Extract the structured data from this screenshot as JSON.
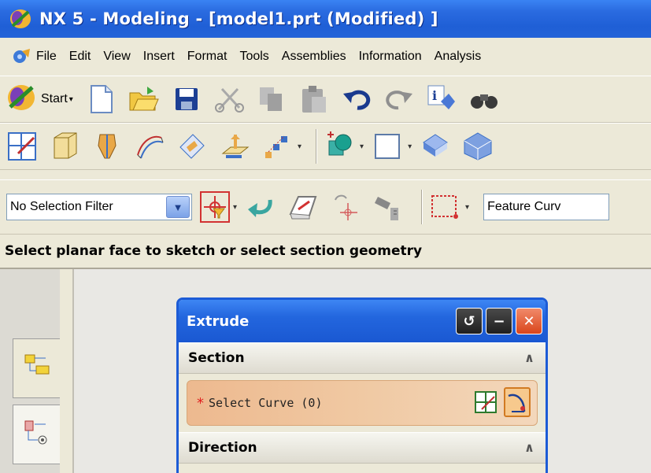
{
  "window": {
    "title": "NX 5 - Modeling - [model1.prt (Modified) ]"
  },
  "menu": {
    "items": [
      {
        "label": "File"
      },
      {
        "label": "Edit"
      },
      {
        "label": "View"
      },
      {
        "label": "Insert"
      },
      {
        "label": "Format"
      },
      {
        "label": "Tools"
      },
      {
        "label": "Assemblies"
      },
      {
        "label": "Information"
      },
      {
        "label": "Analysis"
      }
    ]
  },
  "toolbar1": {
    "start_label": "Start"
  },
  "selection": {
    "filter_value": "No Selection Filter",
    "feature_curve_value": "Feature Curv"
  },
  "cue_line": {
    "text": "Select planar face to sketch or select section geometry"
  },
  "dialog": {
    "title": "Extrude",
    "sections": {
      "section": {
        "label": "Section"
      },
      "direction": {
        "label": "Direction"
      }
    },
    "select_curve": {
      "marker": "*",
      "label": "Select Curve (0)"
    }
  },
  "icons": {
    "app": "nx-logo-icon",
    "menu": "menu-gear-icon"
  }
}
